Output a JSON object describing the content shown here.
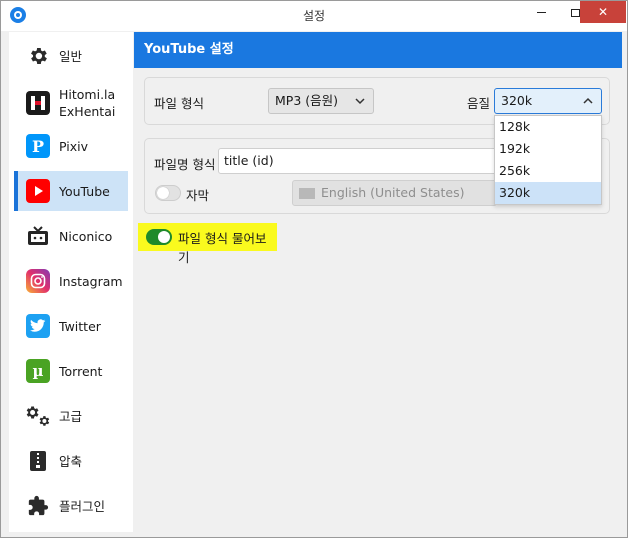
{
  "window": {
    "title": "설정",
    "controls": {
      "minimize": "",
      "maximize": "",
      "close": "✕"
    }
  },
  "sidebar": {
    "items": [
      {
        "label": "일반",
        "icon": "gear-icon",
        "color": "#2b2b2b"
      },
      {
        "label": "Hitomi.la\nExHentai",
        "icon": "hitomi-icon",
        "color": "#c7132b"
      },
      {
        "label": "Pixiv",
        "icon": "pixiv-icon",
        "color": "#0096fa"
      },
      {
        "label": "YouTube",
        "icon": "youtube-icon",
        "color": "#ff0000",
        "active": true
      },
      {
        "label": "Niconico",
        "icon": "niconico-icon",
        "color": "#252525"
      },
      {
        "label": "Instagram",
        "icon": "instagram-icon",
        "color": "#d6249f"
      },
      {
        "label": "Twitter",
        "icon": "twitter-icon",
        "color": "#1da1f2"
      },
      {
        "label": "Torrent",
        "icon": "utorrent-icon",
        "color": "#4aa323"
      },
      {
        "label": "고급",
        "icon": "gears-icon",
        "color": "#2b2b2b"
      },
      {
        "label": "압축",
        "icon": "zip-icon",
        "color": "#2b2b2b"
      },
      {
        "label": "플러그인",
        "icon": "puzzle-icon",
        "color": "#2b2b2b"
      }
    ]
  },
  "content": {
    "header": "YouTube 설정",
    "format": {
      "label": "파일 형식",
      "value": "MP3  (음원)"
    },
    "quality": {
      "label": "음질",
      "value": "320k",
      "options": [
        "128k",
        "192k",
        "256k",
        "320k"
      ],
      "selected_index": 3
    },
    "filename": {
      "label": "파일명 형식",
      "value": "title (id)"
    },
    "subtitle": {
      "label": "자막",
      "enabled": false,
      "language": "English (United States)"
    },
    "ask_format": {
      "label": "파일 형식 물어보기",
      "enabled": true
    }
  },
  "colors": {
    "accent": "#1a78e0",
    "highlight": "#fafa1e",
    "toggle_on": "#1f8a2a"
  }
}
